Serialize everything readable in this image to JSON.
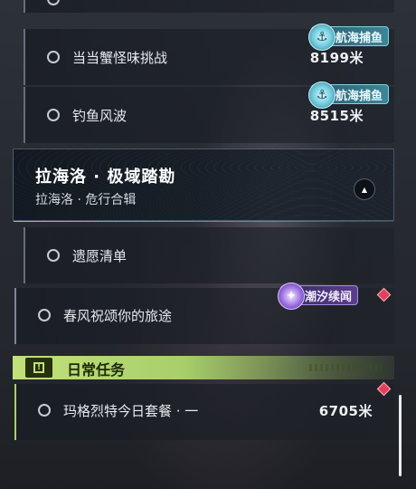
{
  "quests": {
    "top_partial": {
      "label": "",
      "distance": ""
    },
    "crab_challenge": {
      "label": "当当蟹怪味挑战",
      "distance": "8199米",
      "tag": "航海捕鱼"
    },
    "fishing_storm": {
      "label": "钓鱼风波",
      "distance": "8515米",
      "tag": "航海捕鱼"
    }
  },
  "group": {
    "title": "拉海洛 · 极域踏勘",
    "subtitle": "拉海洛 · 危行合辑",
    "items": [
      {
        "label": "遗愿清单"
      },
      {
        "label": "春风祝颂你的旅途",
        "tag": "潮汐续闻"
      }
    ]
  },
  "daily": {
    "section_label": "日常任务",
    "icon_glyph": "!",
    "items": [
      {
        "label": "玛格烈特今日套餐 · 一",
        "distance": "6705米"
      }
    ]
  },
  "icons": {
    "sea_fishing": "anchor-fish-icon",
    "tide": "tide-swirl-icon",
    "collapse": "triangle-up-icon"
  },
  "colors": {
    "daily_accent": "#c2e07a",
    "sea_tag": "#3d8596",
    "tide_tag": "#5a3f8c",
    "alert_diamond": "#e0415a"
  }
}
